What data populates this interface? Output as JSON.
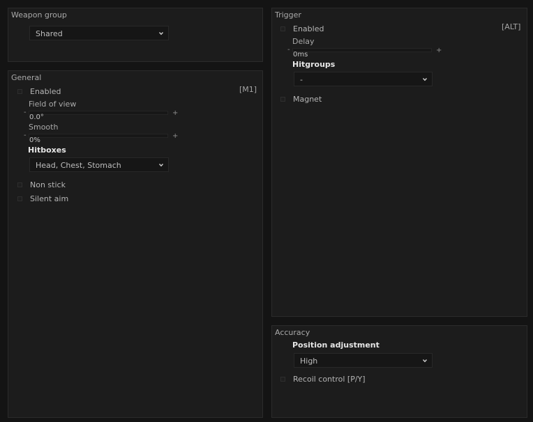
{
  "weapon_group": {
    "title": "Weapon group",
    "selected": "Shared"
  },
  "general": {
    "title": "General",
    "enabled_label": "Enabled",
    "enabled_key": "[M1]",
    "fov_label": "Field of view",
    "fov_value": "0.0°",
    "smooth_label": "Smooth",
    "smooth_value": "0%",
    "hitboxes_label": "Hitboxes",
    "hitboxes_selected": "Head, Chest, Stomach",
    "non_stick_label": "Non stick",
    "silent_aim_label": "Silent aim",
    "minus": "-",
    "plus": "+"
  },
  "trigger": {
    "title": "Trigger",
    "enabled_label": "Enabled",
    "enabled_key": "[ALT]",
    "delay_label": "Delay",
    "delay_value": "0ms",
    "hitgroups_label": "Hitgroups",
    "hitgroups_selected": "-",
    "magnet_label": "Magnet",
    "minus": "-",
    "plus": "+"
  },
  "accuracy": {
    "title": "Accuracy",
    "position_adjustment_label": "Position adjustment",
    "position_adjustment_selected": "High",
    "recoil_control_label": "Recoil control [P/Y]"
  },
  "colors": {
    "background": "#141414",
    "panel": "#1c1c1c",
    "border": "#2b2b2b",
    "text": "#b8b8b8",
    "text_highlight": "#e6e6e6"
  }
}
